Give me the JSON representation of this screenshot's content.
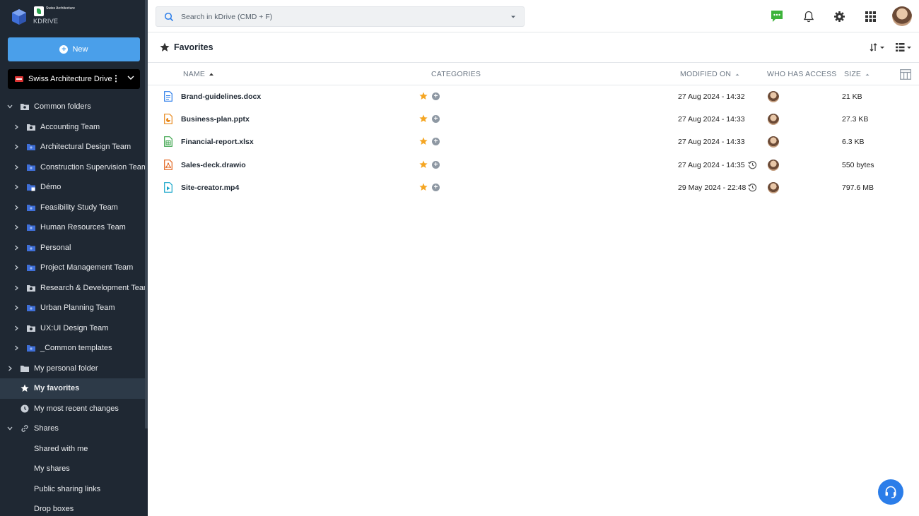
{
  "app": {
    "org_name": "Swiss Architecture",
    "app_name": "KDRIVE",
    "accent": "#4a9fea"
  },
  "sidebar": {
    "new_label": "New",
    "drive_name": "Swiss Architecture Drive",
    "common_folders": "Common folders",
    "folders": [
      {
        "label": "Accounting Team",
        "icon": "shared-folder-icon"
      },
      {
        "label": "Architectural Design Team",
        "icon": "team-folder-icon"
      },
      {
        "label": "Construction Supervision Team",
        "icon": "team-folder-icon"
      },
      {
        "label": "Démo",
        "icon": "sync-folder-icon"
      },
      {
        "label": "Feasibility Study Team",
        "icon": "team-folder-icon"
      },
      {
        "label": "Human Resources Team",
        "icon": "team-folder-icon"
      },
      {
        "label": "Personal",
        "icon": "team-folder-icon"
      },
      {
        "label": "Project Management Team",
        "icon": "team-folder-icon"
      },
      {
        "label": "Research & Development Team",
        "icon": "shared-folder-icon"
      },
      {
        "label": "Urban Planning Team",
        "icon": "team-folder-icon"
      },
      {
        "label": "UX:UI Design Team",
        "icon": "shared-folder-icon"
      },
      {
        "label": "_Common templates",
        "icon": "team-folder-icon"
      }
    ],
    "personal_folder": "My personal folder",
    "favorites": "My favorites",
    "recent": "My most recent changes",
    "shares": "Shares",
    "share_items": [
      "Shared with me",
      "My shares",
      "Public sharing links",
      "Drop boxes"
    ]
  },
  "search": {
    "placeholder": "Search in kDrive (CMD + F)"
  },
  "header": {
    "title": "Favorites"
  },
  "table": {
    "columns": {
      "name": "NAME",
      "categories": "CATEGORIES",
      "modified": "MODIFIED ON",
      "access": "WHO HAS ACCESS",
      "size": "SIZE"
    },
    "rows": [
      {
        "name": "Brand-guidelines.docx",
        "type": "doc",
        "modified": "27 Aug 2024 - 14:32",
        "size": "21 KB",
        "history": false
      },
      {
        "name": "Business-plan.pptx",
        "type": "ppt",
        "modified": "27 Aug 2024 - 14:33",
        "size": "27.3 KB",
        "history": false
      },
      {
        "name": "Financial-report.xlsx",
        "type": "xls",
        "modified": "27 Aug 2024 - 14:33",
        "size": "6.3 KB",
        "history": false
      },
      {
        "name": "Sales-deck.drawio",
        "type": "drawio",
        "modified": "27 Aug 2024 - 14:35",
        "size": "550 bytes",
        "history": true
      },
      {
        "name": "Site-creator.mp4",
        "type": "video",
        "modified": "29 May 2024 - 22:48",
        "size": "797.6 MB",
        "history": true
      }
    ]
  }
}
